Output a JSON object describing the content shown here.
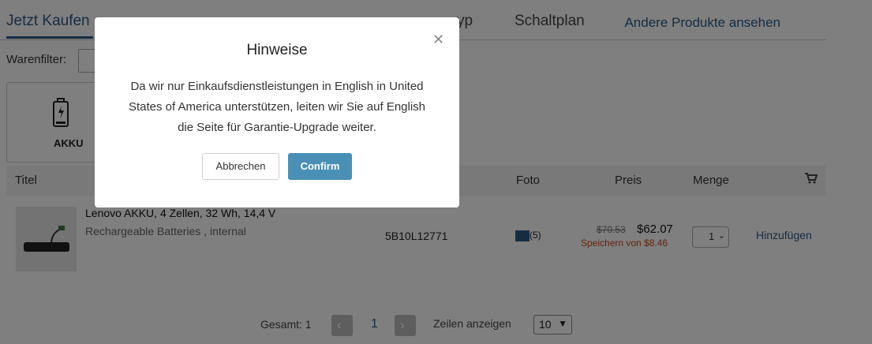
{
  "tabs": {
    "items": [
      {
        "label": "Jetzt Kaufen"
      },
      {
        "label": "yp"
      },
      {
        "label": "Schaltplan"
      }
    ],
    "other_products": "Andere Produkte ansehen"
  },
  "filter": {
    "label": "Warenfilter:"
  },
  "category": {
    "label": "AKKU",
    "icon": "battery-icon"
  },
  "table": {
    "headers": {
      "title": "Titel",
      "photo": "Foto",
      "price": "Preis",
      "qty": "Menge",
      "cart_icon": "cart-icon"
    },
    "rows": [
      {
        "title": "Lenovo AKKU, 4 Zellen, 32 Wh, 14,4 V",
        "subtitle": "Rechargeable Batteries , internal",
        "part": "5B10L12771",
        "photo_count": "(5)",
        "price_old": "$70.53",
        "price_new": "$62.07",
        "price_save": "Speichern von $8.46",
        "qty": "1",
        "add": "Hinzufügen"
      }
    ]
  },
  "pagination": {
    "total": "Gesamt: 1",
    "page": "1",
    "rows_label": "Zeilen anzeigen",
    "page_size": "10"
  },
  "modal": {
    "title": "Hinweise",
    "body": "Da wir nur Einkaufsdienstleistungen in English in United States of America unterstützen, leiten wir Sie auf English die Seite für Garantie-Upgrade weiter.",
    "cancel": "Abbrechen",
    "confirm": "Confirm"
  },
  "colors": {
    "accent": "#2b5b84",
    "confirm": "#4a8fb5",
    "save": "#cc4a1a"
  }
}
